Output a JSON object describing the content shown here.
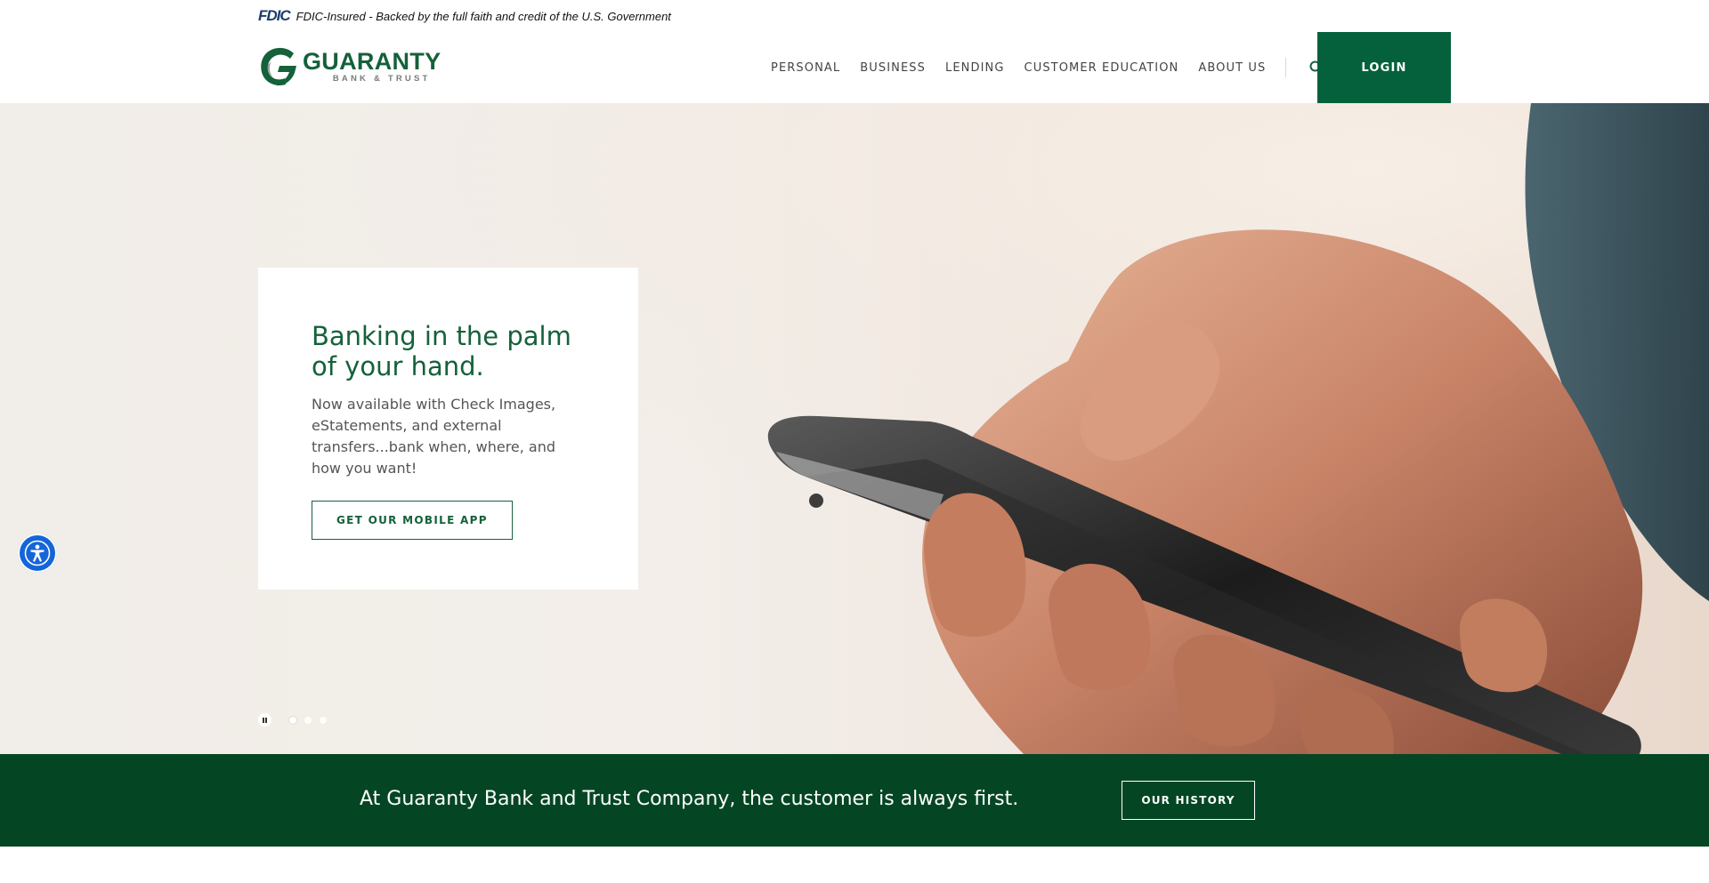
{
  "fdic": {
    "logo": "FDIC",
    "notice": "FDIC-Insured - Backed by the full faith and credit of the U.S. Government"
  },
  "brand": {
    "name": "GUARANTY",
    "sub": "BANK & TRUST",
    "primary_color": "#14613a",
    "dark_green": "#044624"
  },
  "nav": {
    "items": [
      "PERSONAL",
      "BUSINESS",
      "LENDING",
      "CUSTOMER EDUCATION",
      "ABOUT US"
    ],
    "search_icon": "search-icon",
    "login_label": "LOGIN"
  },
  "hero": {
    "title": "Banking in the palm of your hand.",
    "text": "Now available with Check Images, eStatements, and external transfers...bank when, where, and how you want!",
    "cta_label": "GET OUR MOBILE APP",
    "slides_count": 3,
    "active_slide": 1
  },
  "banner": {
    "text": "At Guaranty Bank and Trust Company, the customer is always first.",
    "button_label": "OUR HISTORY"
  },
  "accessibility": {
    "icon": "accessibility-icon",
    "color": "#1565d8"
  }
}
